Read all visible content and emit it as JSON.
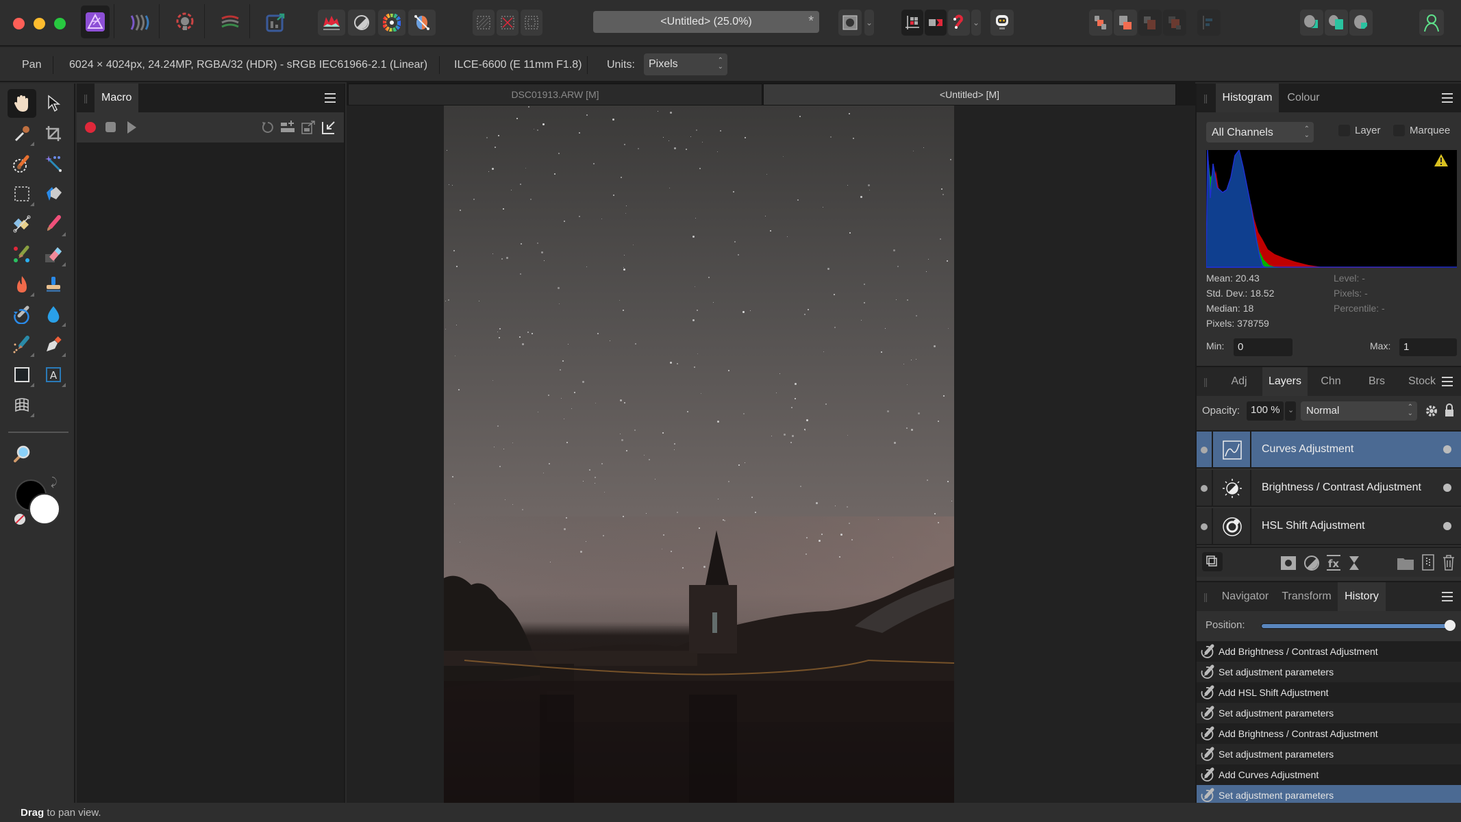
{
  "app": {
    "name": "Affinity Photo",
    "document_title": "<Untitled> (25.0%)",
    "modified_mark": "*"
  },
  "toolbar": {
    "personas": [
      "photo-persona",
      "liquify-persona",
      "develop-persona",
      "tone-mapping-persona",
      "export-persona"
    ],
    "adjust_buttons": [
      "auto-levels",
      "auto-contrast",
      "auto-colour",
      "auto-white-balance"
    ],
    "selection_buttons": [
      "select-all",
      "deselect",
      "invert-selection"
    ],
    "right_groups": [
      "quick-mask",
      "quick-mask-dropdown",
      "snapping-grid",
      "force-pixel-alignment",
      "snapping",
      "snapping-dropdown",
      "assistant",
      "move-forward-one",
      "move-to-front",
      "move-back-one",
      "move-to-back",
      "align",
      "insert-inside",
      "insert-behind",
      "insert-top",
      "account"
    ]
  },
  "context_bar": {
    "tool_name": "Pan",
    "doc_info": "6024 × 4024px, 24.24MP, RGBA/32 (HDR) - sRGB IEC61966-2.1 (Linear)",
    "camera_info": "ILCE-6600 (E 11mm F1.8)",
    "units_label": "Units:",
    "units_value": "Pixels"
  },
  "tools": [
    "view-tool",
    "move-tool",
    "colour-picker-tool",
    "crop-tool",
    "selection-brush-tool",
    "flood-select-tool",
    "rectangular-marquee-tool",
    "flood-fill-tool",
    "gradient-tool",
    "paint-brush-tool",
    "colour-replacement-tool",
    "erase-brush-tool",
    "dodge-brush-tool",
    "clone-brush-tool",
    "undo-brush-tool",
    "blur-brush-tool",
    "healing-brush-tool",
    "pen-tool",
    "rectangle-tool",
    "artistic-text-tool",
    "mesh-warp-tool",
    "zoom-tool"
  ],
  "colours": {
    "primary": "#000000",
    "secondary": "#ffffff",
    "accent": "#4b6a93",
    "record": "#e0283a"
  },
  "macro_panel": {
    "tab": "Macro"
  },
  "document_tabs": [
    {
      "label": "DSC01913.ARW [M]",
      "active": false
    },
    {
      "label": "<Untitled> [M]",
      "active": true
    }
  ],
  "histogram_panel": {
    "tabs": [
      {
        "label": "Histogram",
        "active": true
      },
      {
        "label": "Colour",
        "active": false
      }
    ],
    "channel": "All Channels",
    "layer_label": "Layer",
    "layer_checked": false,
    "marquee_label": "Marquee",
    "marquee_checked": false,
    "stats": {
      "mean": "Mean: 20.43",
      "std_dev": "Std. Dev.: 18.52",
      "median": "Median: 18",
      "pixels": "Pixels: 378759",
      "level": "Level: -",
      "pixels_sel": "Pixels: -",
      "percentile": "Percentile: -"
    },
    "min_label": "Min:",
    "min_value": "0",
    "max_label": "Max:",
    "max_value": "1"
  },
  "layers_panel": {
    "tabs": [
      {
        "label": "Adj",
        "active": false
      },
      {
        "label": "Layers",
        "active": true
      },
      {
        "label": "Chn",
        "active": false
      },
      {
        "label": "Brs",
        "active": false
      },
      {
        "label": "Stock",
        "active": false
      }
    ],
    "opacity_label": "Opacity:",
    "opacity_value": "100 %",
    "blend_mode": "Normal",
    "layers": [
      {
        "name": "Curves Adjustment",
        "icon": "curves-icon",
        "selected": true
      },
      {
        "name": "Brightness / Contrast Adjustment",
        "icon": "brightness-contrast-icon",
        "selected": false
      },
      {
        "name": "HSL Shift Adjustment",
        "icon": "hsl-icon",
        "selected": false
      }
    ]
  },
  "history_panel": {
    "tabs": [
      {
        "label": "Navigator",
        "active": false
      },
      {
        "label": "Transform",
        "active": false
      },
      {
        "label": "History",
        "active": true
      }
    ],
    "position_label": "Position:",
    "position_fraction": 1.0,
    "items": [
      {
        "label": "Add Brightness / Contrast Adjustment",
        "selected": false
      },
      {
        "label": "Set adjustment parameters",
        "selected": false
      },
      {
        "label": "Add HSL Shift Adjustment",
        "selected": false
      },
      {
        "label": "Set adjustment parameters",
        "selected": false
      },
      {
        "label": "Add Brightness / Contrast Adjustment",
        "selected": false
      },
      {
        "label": "Set adjustment parameters",
        "selected": false
      },
      {
        "label": "Add Curves Adjustment",
        "selected": false
      },
      {
        "label": "Set adjustment parameters",
        "selected": true
      }
    ]
  },
  "status_bar": {
    "bold": "Drag",
    "text": " to pan view."
  }
}
